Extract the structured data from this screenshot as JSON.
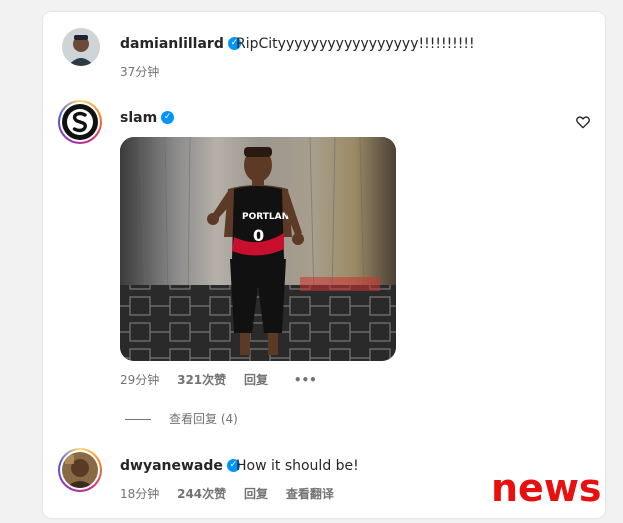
{
  "comments": [
    {
      "username": "damianlillard",
      "text": "RipCityyyyyyyyyyyyyyyyy!!!!!!!!!!",
      "time": "37分钟"
    },
    {
      "username": "slam",
      "time": "29分钟",
      "likes": "321次赞",
      "reply": "回复",
      "more": "•••",
      "view_replies": "查看回复 (4)"
    },
    {
      "username": "dwyanewade",
      "text": "How it should be!",
      "time": "18分钟",
      "likes": "244次赞",
      "reply": "回复",
      "translate": "查看翻译"
    }
  ],
  "colors": {
    "verified": "#0095f6",
    "watermark": "#e8100f"
  },
  "icons": [
    "verified-badge-icon",
    "heart-icon",
    "more-options-icon"
  ],
  "watermark": "news"
}
